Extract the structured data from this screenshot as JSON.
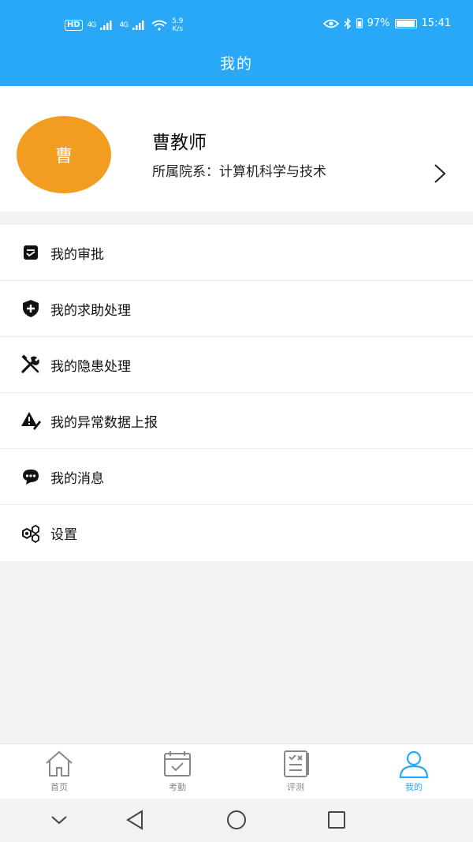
{
  "status_bar": {
    "hd": "HD",
    "net1": "4G",
    "net2": "4G",
    "speed_value": "5.9",
    "speed_unit": "K/s",
    "battery": "97%",
    "battery_level": 0.97,
    "time": "15:41"
  },
  "header": {
    "title": "我的"
  },
  "profile": {
    "avatar_text": "曹",
    "avatar_color": "#f29c20",
    "name": "曹教师",
    "department": "所属院系：计算机科学与技术"
  },
  "menu": {
    "items": [
      {
        "label": "我的审批",
        "icon": "approval-icon"
      },
      {
        "label": "我的求助处理",
        "icon": "help-shield-icon"
      },
      {
        "label": "我的隐患处理",
        "icon": "tools-icon"
      },
      {
        "label": "我的异常数据上报",
        "icon": "warning-report-icon"
      },
      {
        "label": "我的消息",
        "icon": "message-icon"
      },
      {
        "label": "设置",
        "icon": "settings-icon"
      }
    ]
  },
  "tabs": [
    {
      "label": "首页",
      "icon": "home-icon",
      "active": false
    },
    {
      "label": "考勤",
      "icon": "calendar-check-icon",
      "active": false
    },
    {
      "label": "评测",
      "icon": "checklist-icon",
      "active": false
    },
    {
      "label": "我的",
      "icon": "user-icon",
      "active": true
    }
  ],
  "colors": {
    "primary": "#28a8f6",
    "tab_inactive": "#888888"
  }
}
